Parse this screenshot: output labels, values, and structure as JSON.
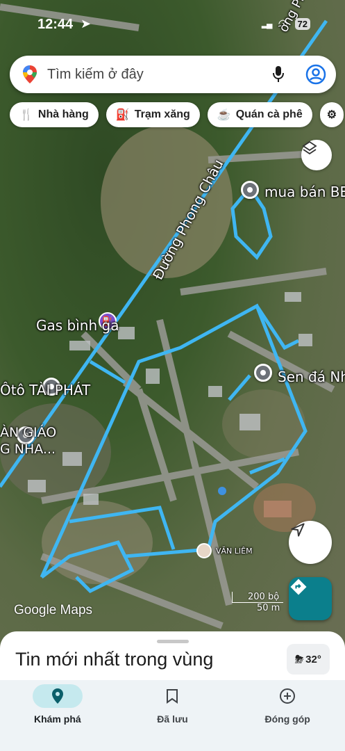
{
  "status_bar": {
    "time": "12:44",
    "battery": "72"
  },
  "search": {
    "placeholder": "Tìm kiếm ở đây"
  },
  "chips": [
    {
      "label": "Nhà hàng",
      "icon": "fork-knife-icon"
    },
    {
      "label": "Trạm xăng",
      "icon": "gas-pump-icon"
    },
    {
      "label": "Quán cà phê",
      "icon": "coffee-cup-icon"
    }
  ],
  "map": {
    "road_label": "Đường Phong Châu",
    "road_label_top": "ờng Phong C",
    "places": [
      {
        "name": "mua bán BE"
      },
      {
        "name": "Gas bình ga"
      },
      {
        "name": "Sen đá Nh"
      },
      {
        "name": "Ôtô TÀI PHÁT"
      },
      {
        "name": "ÀN GIÁO"
      },
      {
        "name": "G NHA..."
      }
    ],
    "user_label": "VĂN LIÊM",
    "attribution": "Google Maps",
    "scale": {
      "imperial": "200 bộ",
      "metric": "50 m"
    },
    "route_color": "#3fb6f2"
  },
  "sheet": {
    "title": "Tin mới nhất trong vùng",
    "weather": "32°"
  },
  "bottom_nav": [
    {
      "label": "Khám phá",
      "icon": "explore-pin-icon",
      "active": true
    },
    {
      "label": "Đã lưu",
      "icon": "bookmark-icon",
      "active": false
    },
    {
      "label": "Đóng góp",
      "icon": "add-circle-icon",
      "active": false
    }
  ]
}
